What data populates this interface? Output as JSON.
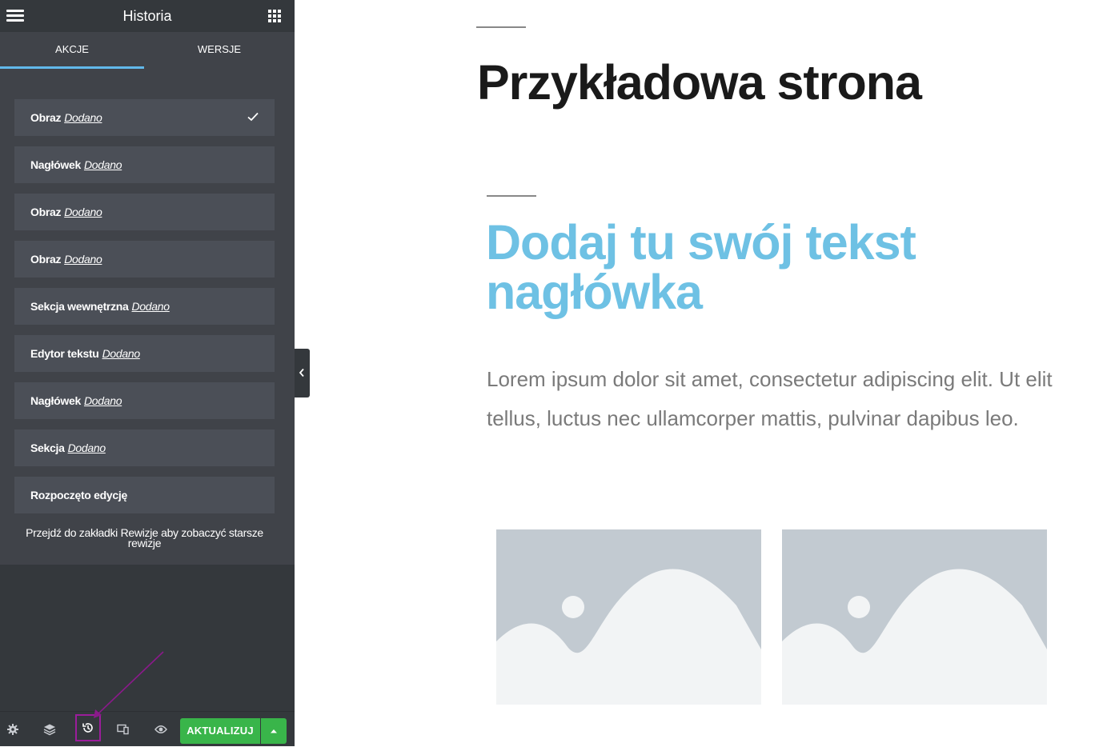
{
  "panel": {
    "title": "Historia",
    "tabs": [
      {
        "label": "AKCJE",
        "active": true
      },
      {
        "label": "WERSJE",
        "active": false
      }
    ],
    "items": [
      {
        "element": "Obraz",
        "action": "Dodano",
        "current": true
      },
      {
        "element": "Nagłówek",
        "action": "Dodano"
      },
      {
        "element": "Obraz",
        "action": "Dodano"
      },
      {
        "element": "Obraz",
        "action": "Dodano"
      },
      {
        "element": "Sekcja wewnętrzna",
        "action": "Dodano"
      },
      {
        "element": "Edytor tekstu",
        "action": "Dodano"
      },
      {
        "element": "Nagłówek",
        "action": "Dodano"
      },
      {
        "element": "Sekcja",
        "action": "Dodano"
      },
      {
        "element": "Rozpoczęto edycję",
        "action": ""
      }
    ],
    "footnote": "Przejdź do zakładki Rewizje aby zobaczyć starsze rewizje"
  },
  "toolbar": {
    "icons": [
      "gear-icon",
      "layers-icon",
      "history-icon",
      "responsive-icon",
      "eye-icon"
    ],
    "update_label": "AKTUALIZUJ"
  },
  "content": {
    "page_title": "Przykładowa strona",
    "heading": "Dodaj tu swój tekst nagłówka",
    "body": "Lorem ipsum dolor sit amet, consectetur adipiscing elit. Ut elit tellus, luctus nec ullamcorper mattis, pulvinar dapibus leo."
  },
  "colors": {
    "sidebar_bg": "#34383c",
    "panel_bg": "#404349",
    "item_bg": "#4b4f57",
    "accent_tab": "#61b8ea",
    "update_green": "#39b54a",
    "heading_blue": "#6ec1e4",
    "annotation_purple": "#9b1d9b"
  }
}
